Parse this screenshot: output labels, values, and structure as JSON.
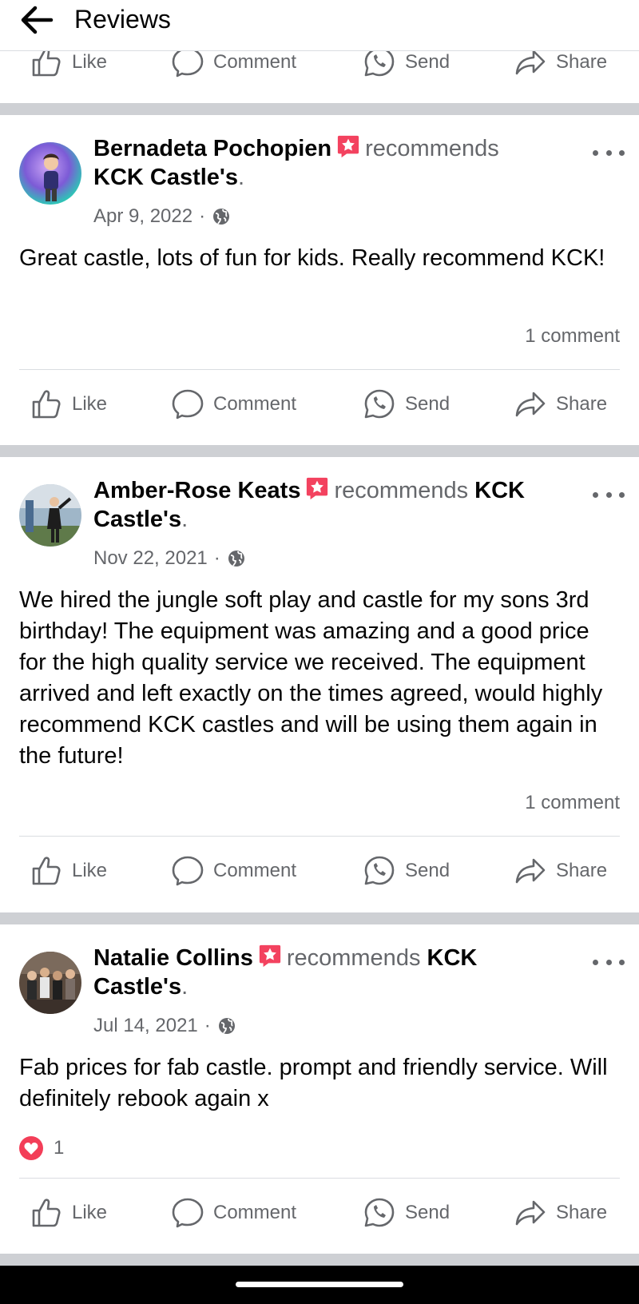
{
  "header": {
    "title": "Reviews"
  },
  "actions": {
    "like": "Like",
    "comment": "Comment",
    "send": "Send",
    "share": "Share"
  },
  "posts": [
    {
      "author": "Bernadeta Pochopien",
      "recommends": "recommends",
      "page": "KCK Castle's",
      "date": "Apr 9, 2022",
      "sep_dot": "·",
      "text": "Great castle, lots of fun for kids. Really recommend KCK!",
      "comments": "1 comment"
    },
    {
      "author": "Amber-Rose Keats",
      "recommends": "recommends",
      "page": "KCK Castle's",
      "date": "Nov 22, 2021",
      "sep_dot": "·",
      "text": "We hired the jungle soft play and castle for my sons 3rd birthday! The equipment was amazing and a good price for the high quality service we received. The equipment arrived and left exactly on the times agreed, would highly recommend KCK castles and will be using them again in the future!",
      "comments": "1 comment"
    },
    {
      "author": "Natalie Collins",
      "recommends": "recommends",
      "page": "KCK Castle's",
      "date": "Jul 14, 2021",
      "sep_dot": "·",
      "text": "Fab prices for fab castle. prompt and friendly service. Will definitely rebook again x",
      "reactions": "1"
    }
  ],
  "colors": {
    "secondary_text": "#65676b",
    "divider": "#ced0d4",
    "love": "#f33e58",
    "badge": "#f3425f"
  }
}
